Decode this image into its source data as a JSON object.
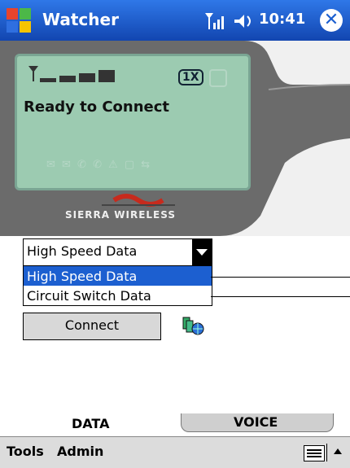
{
  "title_bar": {
    "app_title": "Watcher",
    "time": "10:41",
    "close_glyph": "✕",
    "accent": "#1c5fd0"
  },
  "device_panel": {
    "status": "Ready to Connect",
    "badge": "1X",
    "brand": "SIERRA WIRELESS",
    "screen_color": "#9ccbb1"
  },
  "connection_type": {
    "selected": "High Speed Data",
    "options": [
      "High Speed Data",
      "Circuit Switch Data"
    ]
  },
  "buttons": {
    "connect": "Connect"
  },
  "tabs": {
    "data": "DATA",
    "voice": "VOICE"
  },
  "menubar": {
    "tools": "Tools",
    "admin": "Admin"
  }
}
